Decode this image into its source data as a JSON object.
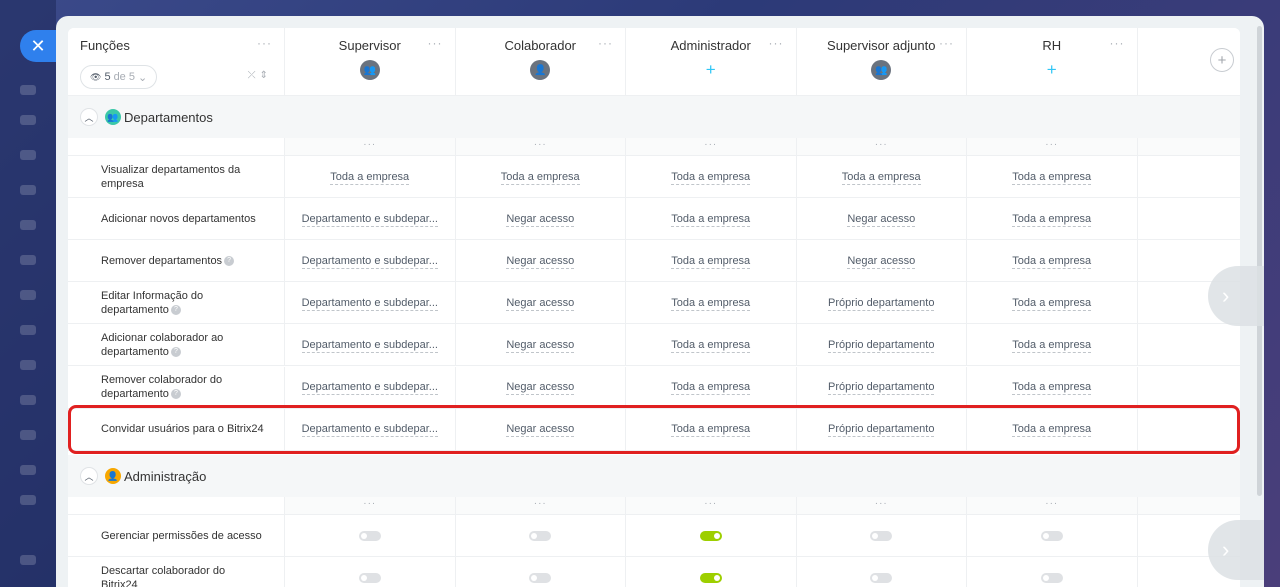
{
  "header": {
    "title": "Funções",
    "counter_value": "5",
    "counter_suffix": "de 5",
    "roles": [
      {
        "name": "Supervisor",
        "icon": "group-avatar-icon"
      },
      {
        "name": "Colaborador",
        "icon": "user-avatar-icon"
      },
      {
        "name": "Administrador",
        "icon": "plus-icon"
      },
      {
        "name": "Supervisor adjunto",
        "icon": "group-avatar-icon"
      },
      {
        "name": "RH",
        "icon": "plus-icon"
      }
    ]
  },
  "groups": [
    {
      "title": "Departamentos",
      "icon_color": "#3bc8a8",
      "rows": [
        {
          "label": "Visualizar departamentos da empresa",
          "help": false,
          "values": [
            "Toda a empresa",
            "Toda a empresa",
            "Toda a empresa",
            "Toda a empresa",
            "Toda a empresa"
          ]
        },
        {
          "label": "Adicionar novos departamentos",
          "help": false,
          "values": [
            "Departamento e subdepar...",
            "Negar acesso",
            "Toda a empresa",
            "Negar acesso",
            "Toda a empresa"
          ]
        },
        {
          "label": "Remover departamentos",
          "help": true,
          "values": [
            "Departamento e subdepar...",
            "Negar acesso",
            "Toda a empresa",
            "Negar acesso",
            "Toda a empresa"
          ]
        },
        {
          "label": "Editar Informação do departamento",
          "help": true,
          "values": [
            "Departamento e subdepar...",
            "Negar acesso",
            "Toda a empresa",
            "Próprio departamento",
            "Toda a empresa"
          ]
        },
        {
          "label": "Adicionar colaborador ao departamento",
          "help": true,
          "values": [
            "Departamento e subdepar...",
            "Negar acesso",
            "Toda a empresa",
            "Próprio departamento",
            "Toda a empresa"
          ]
        },
        {
          "label": "Remover colaborador do departamento",
          "help": true,
          "values": [
            "Departamento e subdepar...",
            "Negar acesso",
            "Toda a empresa",
            "Próprio departamento",
            "Toda a empresa"
          ]
        },
        {
          "label": "Convidar usuários para o Bitrix24",
          "help": false,
          "values": [
            "Departamento e subdepar...",
            "Negar acesso",
            "Toda a empresa",
            "Próprio departamento",
            "Toda a empresa"
          ]
        }
      ]
    },
    {
      "title": "Administração",
      "icon_color": "#f7a700",
      "rows": [
        {
          "label": "Gerenciar permissões de acesso",
          "help": false,
          "toggles": [
            false,
            false,
            true,
            false,
            false
          ]
        },
        {
          "label": "Descartar colaborador do Bitrix24",
          "help": false,
          "toggles": [
            false,
            false,
            true,
            false,
            false
          ]
        }
      ]
    }
  ],
  "colors": {
    "accent": "#2f80ed",
    "toggle_on": "#9dcf00",
    "highlight": "#e02020"
  }
}
